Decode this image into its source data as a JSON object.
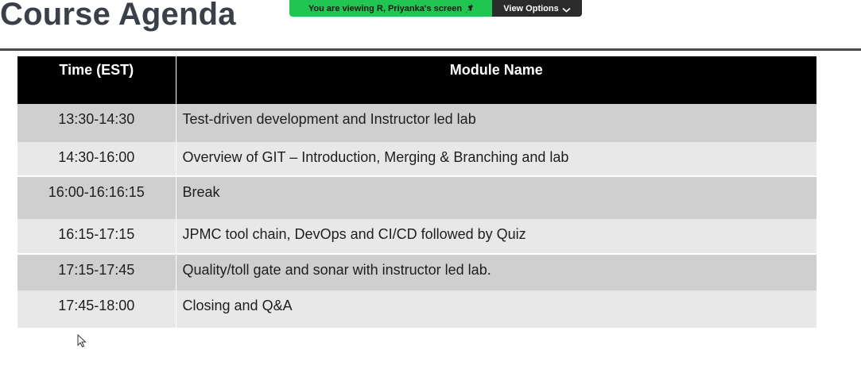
{
  "slide": {
    "title": "Course Agenda"
  },
  "share_banner": {
    "status_text": "You are viewing  R, Priyanka's screen",
    "view_options_label": "View Options",
    "status_color": "#21c552",
    "options_color": "#2b2b2b"
  },
  "agenda_table": {
    "headers": {
      "time": "Time (EST)",
      "module": "Module Name"
    },
    "rows": [
      {
        "time": "13:30-14:30",
        "module": "Test-driven development and Instructor led lab"
      },
      {
        "time": "14:30-16:00",
        "module": "Overview of GIT – Introduction, Merging & Branching and lab"
      },
      {
        "time": "16:00-16:16:15",
        "module": "Break"
      },
      {
        "time": "16:15-17:15",
        "module": "JPMC tool chain, DevOps and CI/CD followed by Quiz"
      },
      {
        "time": "17:15-17:45",
        "module": "Quality/toll gate and sonar with instructor led lab."
      },
      {
        "time": "17:45-18:00",
        "module": "Closing and Q&A"
      }
    ]
  },
  "icons": {
    "share_status": "pin-icon",
    "view_options": "chevron-down-icon",
    "pointer": "mouse-cursor-icon"
  }
}
